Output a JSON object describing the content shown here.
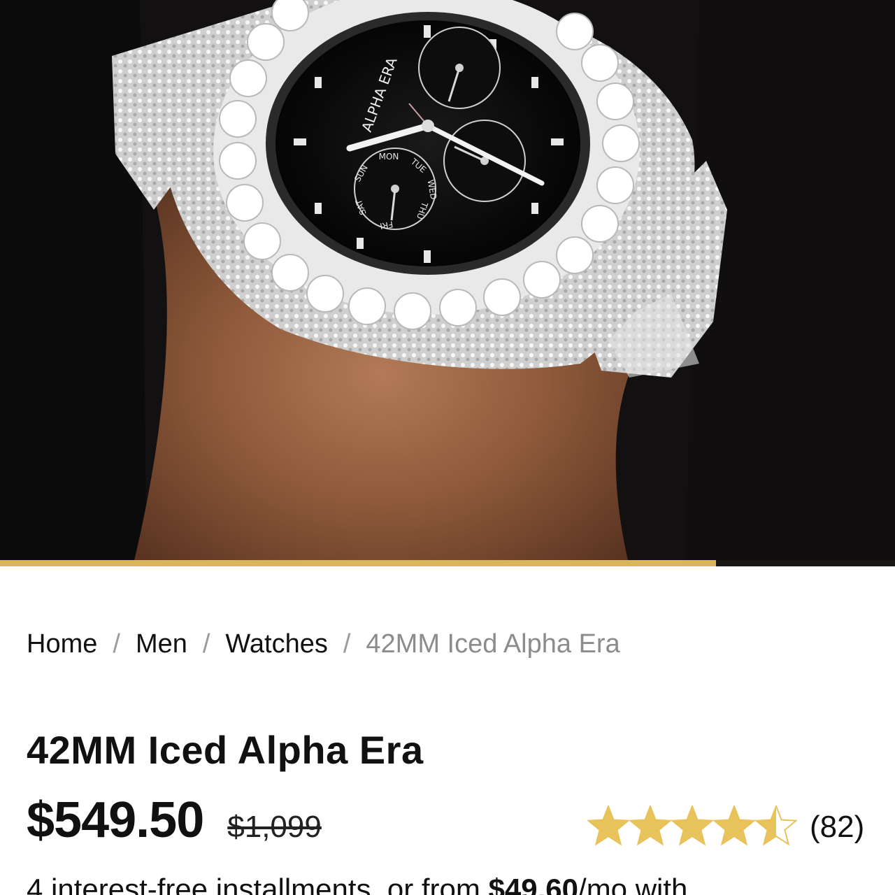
{
  "hero": {
    "image_alt": "Iced watch on wrist",
    "watch": {
      "brand_text": "ALPHA ERA",
      "day_labels": [
        "SUN",
        "MON",
        "TUE",
        "WED",
        "THU",
        "FRI",
        "SAT"
      ]
    },
    "gallery_progress": 0.8
  },
  "breadcrumb": {
    "items": [
      "Home",
      "Men",
      "Watches"
    ],
    "separator": "/",
    "current": "42MM Iced Alpha Era"
  },
  "product": {
    "title": "42MM Iced Alpha Era",
    "price": "$549.50",
    "compare_price": "$1,099",
    "rating": {
      "stars": 4.5,
      "max": 5,
      "count_label": "(82)",
      "star_color": "#e8c25a"
    },
    "installments": {
      "prefix": "4 interest-free installments, or from ",
      "amount": "$49.60",
      "suffix": "/mo with"
    }
  },
  "colors": {
    "accent": "#d9b659",
    "text": "#111111",
    "muted": "#8c8c8c"
  }
}
